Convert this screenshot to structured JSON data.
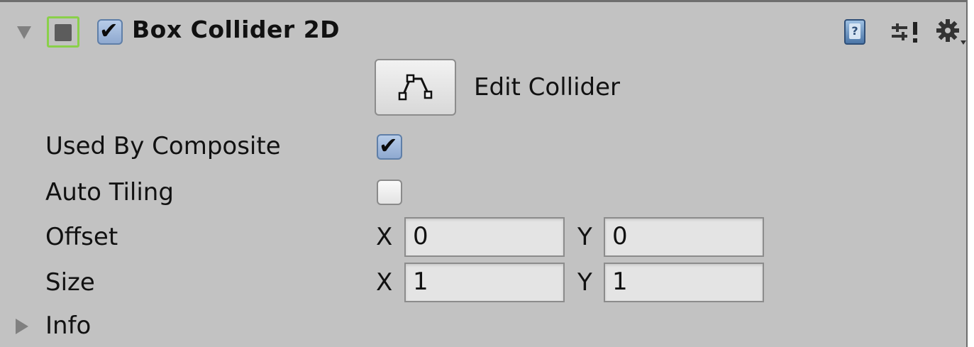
{
  "component": {
    "title": "Box Collider 2D",
    "enabled": true
  },
  "header_icons": [
    "foldout-expanded-icon",
    "component-type-icon",
    "help-book-icon",
    "presets-icon",
    "gear-icon"
  ],
  "edit_collider": {
    "icon": "polygon-edit-icon",
    "label": "Edit Collider"
  },
  "properties": {
    "used_by_composite": {
      "label": "Used By Composite",
      "checked": true
    },
    "auto_tiling": {
      "label": "Auto Tiling",
      "checked": false
    },
    "offset": {
      "label": "Offset",
      "x_label": "X",
      "x": "0",
      "y_label": "Y",
      "y": "0"
    },
    "size": {
      "label": "Size",
      "x_label": "X",
      "x": "1",
      "y_label": "Y",
      "y": "1"
    }
  },
  "info": {
    "label": "Info",
    "expanded": false
  },
  "colors": {
    "panel": "#c2c2c2",
    "checkbox_on": "#9fb8dc",
    "type_icon_border": "#8ad04a"
  }
}
